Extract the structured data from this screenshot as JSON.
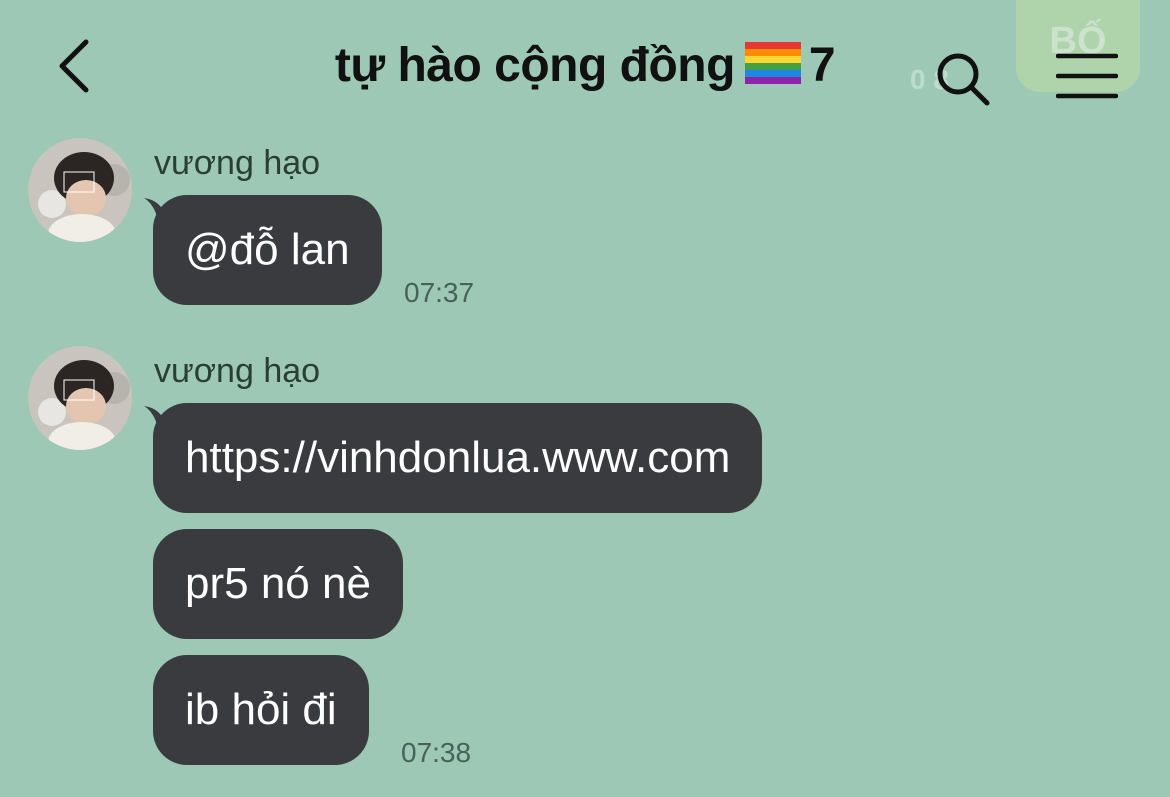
{
  "header": {
    "title": "tự hào cộng đồng",
    "member_count": "7",
    "ghost_time": "0 8",
    "ghost_badge": "BỐ",
    "icons": [
      "back-chevron-icon",
      "rainbow-flag-icon",
      "search-icon",
      "menu-icon"
    ]
  },
  "messages": [
    {
      "sender": "vương hạo",
      "bubbles": [
        "@đỗ lan"
      ],
      "time": "07:37"
    },
    {
      "sender": "vương hạo",
      "bubbles": [
        "https://vinhdonlua.www.com",
        "pr5 nó nè",
        "ib hỏi đi"
      ],
      "time": "07:38"
    }
  ],
  "colors": {
    "background": "#9dc8b6",
    "bubble": "#3a3b3e",
    "bubble_text": "#ffffff",
    "timestamp": "#48625a"
  }
}
